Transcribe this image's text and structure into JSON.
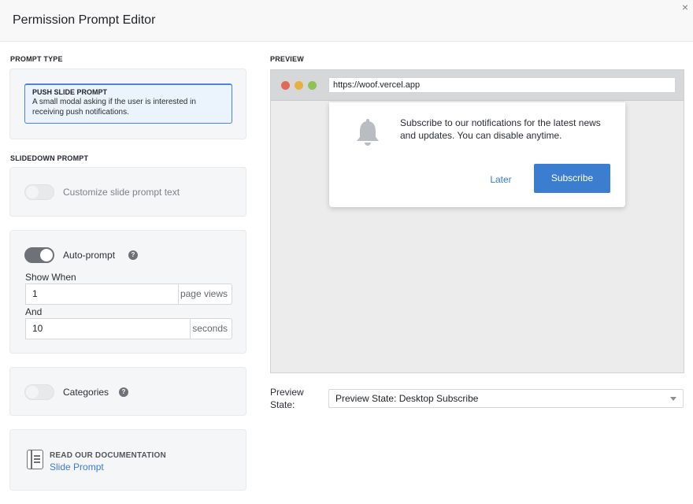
{
  "dialog": {
    "title": "Permission Prompt Editor",
    "close_glyph": "×"
  },
  "prompt_type": {
    "section_label": "PROMPT TYPE",
    "selected": {
      "title": "PUSH SLIDE PROMPT",
      "description": "A small modal asking if the user is interested in receiving push notifications."
    }
  },
  "slidedown": {
    "section_label": "SLIDEDOWN PROMPT",
    "customize": {
      "label": "Customize slide prompt text",
      "enabled": false
    },
    "auto_prompt": {
      "label": "Auto-prompt",
      "enabled": true,
      "help_glyph": "?",
      "show_when_label": "Show When",
      "page_views_value": "1",
      "page_views_unit": "page views",
      "and_label": "And",
      "seconds_value": "10",
      "seconds_unit": "seconds"
    },
    "categories": {
      "label": "Categories",
      "enabled": false,
      "help_glyph": "?"
    }
  },
  "documentation": {
    "heading": "READ OUR DOCUMENTATION",
    "link_text": "Slide Prompt",
    "icon": "document-icon"
  },
  "preview": {
    "section_label": "PREVIEW",
    "url": "https://woof.vercel.app",
    "traffic_lights": [
      "#e06a5a",
      "#e6b043",
      "#8ec255"
    ],
    "message": "Subscribe to our notifications for the latest news and updates. You can disable anytime.",
    "later_label": "Later",
    "subscribe_label": "Subscribe",
    "icon": "bell-icon"
  },
  "preview_state": {
    "label": "Preview State:",
    "selected": "Preview State: Desktop Subscribe"
  },
  "colors": {
    "accent": "#3b7ed0",
    "toggle_on": "#6e7177"
  }
}
